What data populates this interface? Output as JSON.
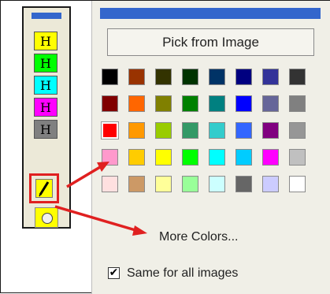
{
  "toolbar": {
    "buttons": [
      {
        "label": "H",
        "color": "#ffff00"
      },
      {
        "label": "H",
        "color": "#00ff00"
      },
      {
        "label": "H",
        "color": "#00ffff"
      },
      {
        "label": "H",
        "color": "#ff00ff"
      },
      {
        "label": "H",
        "color": "#808080"
      }
    ]
  },
  "picker": {
    "pick_from_image_label": "Pick from Image",
    "swatch_rows": [
      [
        "#000000",
        "#993300",
        "#333300",
        "#003300",
        "#003366",
        "#000080",
        "#333399",
        "#333333"
      ],
      [
        "#800000",
        "#ff6600",
        "#808000",
        "#008000",
        "#008080",
        "#0000ff",
        "#666699",
        "#808080"
      ],
      [
        "#ff0000",
        "#ff9900",
        "#99cc00",
        "#339966",
        "#33cccc",
        "#3366ff",
        "#800080",
        "#969696"
      ],
      [
        "#ff99cc",
        "#ffcc00",
        "#ffff00",
        "#00ff00",
        "#00ffff",
        "#00ccff",
        "#ff00ff",
        "#c0c0c0"
      ],
      [
        "#ffe0e0",
        "#cc9966",
        "#ffff99",
        "#99ff99",
        "#ccffff",
        "#666666",
        "#ccccff",
        "#ffffff"
      ]
    ],
    "selected_color": "#ff0000",
    "more_colors_label": "More Colors...",
    "same_for_all_label": "Same for all images",
    "same_for_all_checked": true,
    "checkbox_glyph": "✔"
  },
  "annotation_color": "#e02020"
}
